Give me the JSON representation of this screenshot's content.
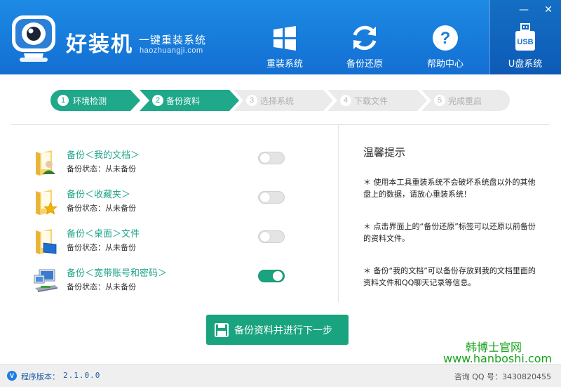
{
  "app": {
    "name": "好装机",
    "slogan": "一键重装系统",
    "url": "haozhuangji.com"
  },
  "window": {
    "minimize": "—",
    "close": "✕"
  },
  "nav": [
    {
      "label": "重装系统",
      "icon": "windows-icon",
      "active": false
    },
    {
      "label": "备份还原",
      "icon": "refresh-icon",
      "active": false
    },
    {
      "label": "帮助中心",
      "icon": "help-icon",
      "active": false
    },
    {
      "label": "U盘系统",
      "icon": "usb-icon",
      "active": true,
      "icon_text": "USB"
    }
  ],
  "steps": [
    {
      "num": "1",
      "label": "环境检测",
      "state": "done"
    },
    {
      "num": "2",
      "label": "备份资料",
      "state": "done"
    },
    {
      "num": "3",
      "label": "选择系统",
      "state": "todo"
    },
    {
      "num": "4",
      "label": "下载文件",
      "state": "todo"
    },
    {
      "num": "5",
      "label": "完成重启",
      "state": "todo"
    }
  ],
  "backup_items": [
    {
      "title": "备份＜我的文档＞",
      "status": "备份状态：从未备份",
      "icon": "documents-folder-icon",
      "enabled": false
    },
    {
      "title": "备份＜收藏夹＞",
      "status": "备份状态：从未备份",
      "icon": "favorites-folder-icon",
      "enabled": false
    },
    {
      "title": "备份＜桌面＞文件",
      "status": "备份状态：从未备份",
      "icon": "desktop-folder-icon",
      "enabled": false
    },
    {
      "title": "备份＜宽带账号和密码＞",
      "status": "备份状态：从未备份",
      "icon": "network-icon",
      "enabled": true
    }
  ],
  "tips": {
    "title": "温馨提示",
    "items": [
      "＊ 使用本工具重装系统不会破坏系统盘以外的其他盘上的数据，请放心重装系统！",
      "＊ 点击界面上的“备份还原”标签可以还原以前备份的资料文件。",
      "＊ 备份“我的文档”可以备份存放到我的文档里面的资料文件和QQ聊天记录等信息。"
    ]
  },
  "next_button": {
    "label": "备份资料并进行下一步",
    "icon": "save-icon"
  },
  "watermark": {
    "line1": "韩博士官网",
    "line2": "www.hanboshi.com"
  },
  "footer": {
    "version_icon": "V",
    "version_label": "程序版本：",
    "version": "2.1.0.0",
    "qq": "咨询 QQ 号：3430820455"
  },
  "colors": {
    "header_blue": "#1a80dc",
    "accent_green": "#1aa37f",
    "step_pending": "#ebebeb",
    "watermark_green": "#16a31b"
  }
}
